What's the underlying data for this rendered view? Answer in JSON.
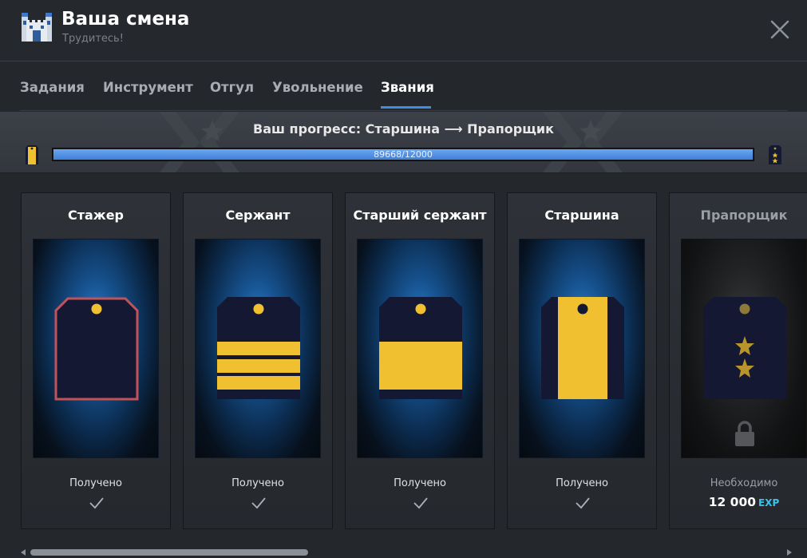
{
  "window": {
    "title": "Ваша смена",
    "subtitle": "Трудитесь!",
    "icon": "castle-icon",
    "close_icon": "close-icon"
  },
  "tabs": [
    {
      "label": "Задания",
      "active": false
    },
    {
      "label": "Инструмент",
      "active": false
    },
    {
      "label": "Отгул",
      "active": false
    },
    {
      "label": "Увольнение",
      "active": false
    },
    {
      "label": "Звания",
      "active": true
    }
  ],
  "progress": {
    "label_prefix": "Ваш прогресс:",
    "current_rank": "Старшина",
    "arrow": "⟶",
    "next_rank": "Прапорщик",
    "value": 89668,
    "max": 12000,
    "fill_fraction": 1.0,
    "text": "89668/12000",
    "fill_color": "#4a8ae0"
  },
  "ranks": [
    {
      "name": "Стажер",
      "status": "Получено",
      "obtained": true,
      "insignia": "epaulette-blank-icon"
    },
    {
      "name": "Сержант",
      "status": "Получено",
      "obtained": true,
      "insignia": "epaulette-three-stripes-icon"
    },
    {
      "name": "Старший сержант",
      "status": "Получено",
      "obtained": true,
      "insignia": "epaulette-wide-stripe-icon"
    },
    {
      "name": "Старшина",
      "status": "Получено",
      "obtained": true,
      "insignia": "epaulette-long-stripe-icon"
    },
    {
      "name": "Прапорщик",
      "status": "Необходимо",
      "obtained": false,
      "required_amount": "12 000",
      "required_unit": "EXP",
      "insignia": "epaulette-two-stars-icon",
      "lock_icon": "lock-icon"
    }
  ],
  "colors": {
    "accent": "#3b8ee6",
    "stripe_gold": "#f0c030",
    "exp_cyan": "#35c6ef"
  }
}
